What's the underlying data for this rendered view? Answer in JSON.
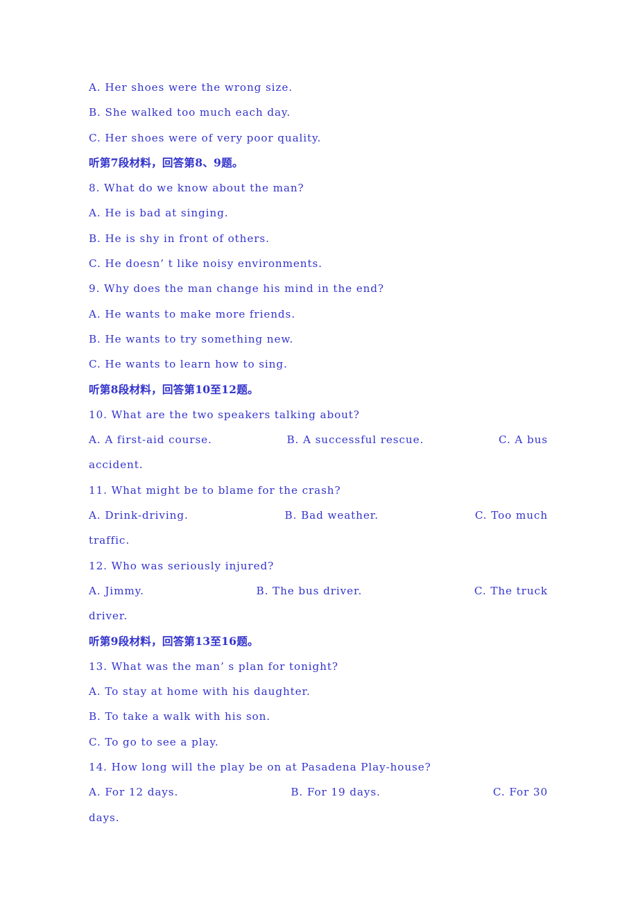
{
  "page": {
    "text_color": "#3333cc",
    "background_color": "#ffffff",
    "subject": "English Listening Comprehension"
  },
  "lines": [
    {
      "id": "q7-opt-a",
      "kind": "option",
      "text": "A. Her shoes were the wrong size."
    },
    {
      "id": "q7-opt-b",
      "kind": "option",
      "text": "B. She walked too much each day."
    },
    {
      "id": "q7-opt-c",
      "kind": "option",
      "text": "C. Her shoes were of very poor quality."
    },
    {
      "id": "section-7-heading",
      "kind": "section-heading",
      "text": "听第7段材料，回答第8、9题。"
    },
    {
      "id": "q8-stem",
      "kind": "question",
      "text": "8. What do we know about the man?"
    },
    {
      "id": "q8-opt-a",
      "kind": "option",
      "text": "A. He is bad at singing."
    },
    {
      "id": "q8-opt-b",
      "kind": "option",
      "text": "B. He is shy in front of others."
    },
    {
      "id": "q8-opt-c",
      "kind": "option",
      "text": "C. He doesn’ t like noisy environments."
    },
    {
      "id": "q9-stem",
      "kind": "question",
      "text": "9. Why does the man change his mind in the end?"
    },
    {
      "id": "q9-opt-a",
      "kind": "option",
      "text": "A. He wants to make more friends."
    },
    {
      "id": "q9-opt-b",
      "kind": "option",
      "text": "B. He wants to try something new."
    },
    {
      "id": "q9-opt-c",
      "kind": "option",
      "text": "C. He wants to learn how to sing."
    },
    {
      "id": "section-8-heading",
      "kind": "section-heading",
      "text": "听第8段材料，回答第10至12题。"
    },
    {
      "id": "q10-stem",
      "kind": "question",
      "text": "10. What are the two speakers talking about?"
    }
  ],
  "q10_options": {
    "id": "q10-option-row",
    "a": "A. A first-aid course.",
    "b": "B. A successful rescue.",
    "c": "C.  A bus",
    "tail": "accident."
  },
  "q11": {
    "stem": {
      "id": "q11-stem",
      "text": "11. What might be to blame for the crash?"
    },
    "options": {
      "id": "q11-option-row",
      "a": "A. Drink-driving.",
      "b": "B. Bad weather.",
      "c": "C.   Too   much",
      "tail": "traffic."
    }
  },
  "q12": {
    "stem": {
      "id": "q12-stem",
      "text": "12. Who was seriously injured?"
    },
    "options": {
      "id": "q12-option-row",
      "a": "A. Jimmy.",
      "b": "B. The bus driver.",
      "c": "C. The  truck",
      "tail": "driver."
    }
  },
  "section_9_heading": {
    "id": "section-9-heading",
    "text": "听第9段材料，回答第13至16题。"
  },
  "q13": {
    "stem": {
      "id": "q13-stem",
      "text": "13. What was the man’ s plan for tonight?"
    },
    "opt_a": {
      "id": "q13-opt-a",
      "text": "A. To stay at home with his daughter."
    },
    "opt_b": {
      "id": "q13-opt-b",
      "text": "B. To take a walk with his son."
    },
    "opt_c": {
      "id": "q13-opt-c",
      "text": "C. To go to see a play."
    }
  },
  "q14": {
    "stem": {
      "id": "q14-stem",
      "text": "14. How long will the play be on at Pasadena Play-house?"
    },
    "options": {
      "id": "q14-option-row",
      "a": "A. For 12 days.",
      "b": "B. For 19 days.",
      "c": "C.   For   30",
      "tail": "days."
    }
  }
}
